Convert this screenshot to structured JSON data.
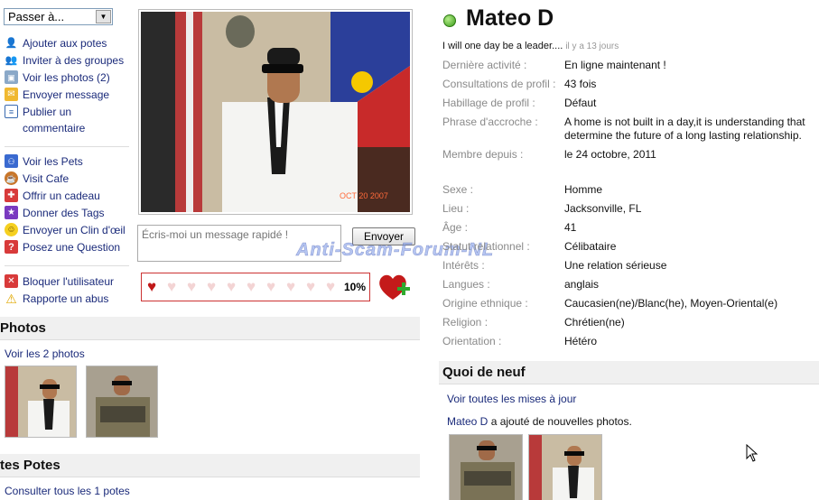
{
  "jump_select": {
    "value": "Passer à..."
  },
  "menu_actions": [
    {
      "label": "Ajouter aux potes",
      "icon": "add-friend-icon"
    },
    {
      "label": "Inviter à des groupes",
      "icon": "group-invite-icon"
    },
    {
      "label": "Voir les photos (2)",
      "icon": "camera-icon"
    },
    {
      "label": "Envoyer message",
      "icon": "envelope-icon"
    },
    {
      "label": "Publier un commentaire",
      "icon": "comment-icon"
    }
  ],
  "menu_social": [
    {
      "label": "Voir les Pets",
      "icon": "pets-icon"
    },
    {
      "label": "Visit Cafe",
      "icon": "cafe-icon"
    },
    {
      "label": "Offrir un cadeau",
      "icon": "gift-icon"
    },
    {
      "label": "Donner des Tags",
      "icon": "star-icon"
    },
    {
      "label": "Envoyer un Clin d'œil",
      "icon": "smiley-icon"
    },
    {
      "label": "Posez une Question",
      "icon": "question-icon"
    }
  ],
  "menu_safety": [
    {
      "label": "Bloquer l'utilisateur",
      "icon": "block-icon"
    },
    {
      "label": "Rapporte un abus",
      "icon": "warning-icon"
    }
  ],
  "quick_message": {
    "placeholder": "Écris-moi un message rapidé !",
    "send_label": "Envoyer"
  },
  "heart_meter": {
    "level": 0.1,
    "percent_label": "10%",
    "hearts_total": 10
  },
  "watermark": "Anti-Scam-Forum-NL",
  "photos_section": {
    "title": "Photos",
    "link": "Voir les 2 photos"
  },
  "friends_section": {
    "title": "tes Potes",
    "link": "Consulter tous les 1 potes"
  },
  "profile": {
    "name": "Mateo D",
    "status": "online",
    "tagline": "I will one day be a leader....",
    "tagline_ago": "il y a 13 jours",
    "rows_top": [
      {
        "key": "Dernière activité :",
        "value": "En ligne maintenant !"
      },
      {
        "key": "Consultations de profil :",
        "value": "43 fois"
      },
      {
        "key": "Habillage de profil :",
        "value": "Défaut"
      },
      {
        "key": "Phrase d'accroche :",
        "value": "A home is not built in a day,it is understanding that determine the future of a long lasting relationship."
      },
      {
        "key": "Membre depuis :",
        "value": "le 24 octobre, 2011"
      }
    ],
    "rows_bottom": [
      {
        "key": "Sexe :",
        "value": "Homme"
      },
      {
        "key": "Lieu :",
        "value": "Jacksonville, FL"
      },
      {
        "key": "Âge :",
        "value": "41"
      },
      {
        "key": "Statut relationnel :",
        "value": "Célibataire"
      },
      {
        "key": "Intérêts :",
        "value": "Une relation sérieuse"
      },
      {
        "key": "Langues :",
        "value": "anglais"
      },
      {
        "key": "Origine ethnique :",
        "value": "Caucasien(ne)/Blanc(he), Moyen-Oriental(e)"
      },
      {
        "key": "Religion :",
        "value": "Chrétien(ne)"
      },
      {
        "key": "Orientation :",
        "value": "Hétéro"
      }
    ]
  },
  "news_section": {
    "title": "Quoi de neuf",
    "link": "Voir toutes les mises à jour",
    "item_user": "Mateo D",
    "item_text": " a ajouté de nouvelles photos."
  },
  "photo_date_stamp": "OCT 20 2007"
}
